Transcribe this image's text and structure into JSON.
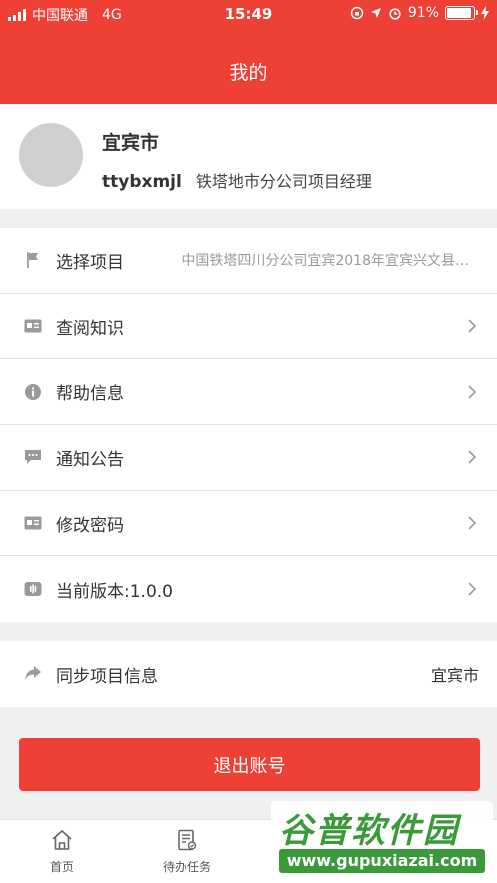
{
  "status_bar": {
    "carrier": "中国联通",
    "network": "4G",
    "time": "15:49",
    "battery": "91%",
    "battery_level": 0.91
  },
  "header": {
    "title": "我的"
  },
  "profile": {
    "city": "宜宾市",
    "username": "ttybxmjl",
    "role": "铁塔地市分公司项目经理"
  },
  "menu": {
    "items": [
      {
        "label": "选择项目",
        "value": "中国铁塔四川分公司宜宾2018年宜宾兴文县…",
        "icon": "flag-icon"
      },
      {
        "label": "查阅知识",
        "icon": "id-card-icon"
      },
      {
        "label": "帮助信息",
        "icon": "info-icon"
      },
      {
        "label": "通知公告",
        "icon": "message-icon"
      },
      {
        "label": "修改密码",
        "icon": "id-card-icon"
      },
      {
        "label": "当前版本:1.0.0",
        "icon": "version-icon"
      }
    ]
  },
  "sync": {
    "label": "同步项目信息",
    "value": "宜宾市",
    "icon": "share-arrow-icon"
  },
  "logout": {
    "label": "退出账号"
  },
  "tabbar": {
    "tabs": [
      {
        "label": "首页",
        "icon": "home-icon"
      },
      {
        "label": "待办任务",
        "icon": "task-icon"
      }
    ]
  },
  "watermark": {
    "title": "谷普软件园",
    "url": "www.gupuxiazai.com"
  },
  "colors": {
    "accent": "#ef4036",
    "icon_gray": "#9a9a9a",
    "watermark_green": "#3a9a3a"
  }
}
